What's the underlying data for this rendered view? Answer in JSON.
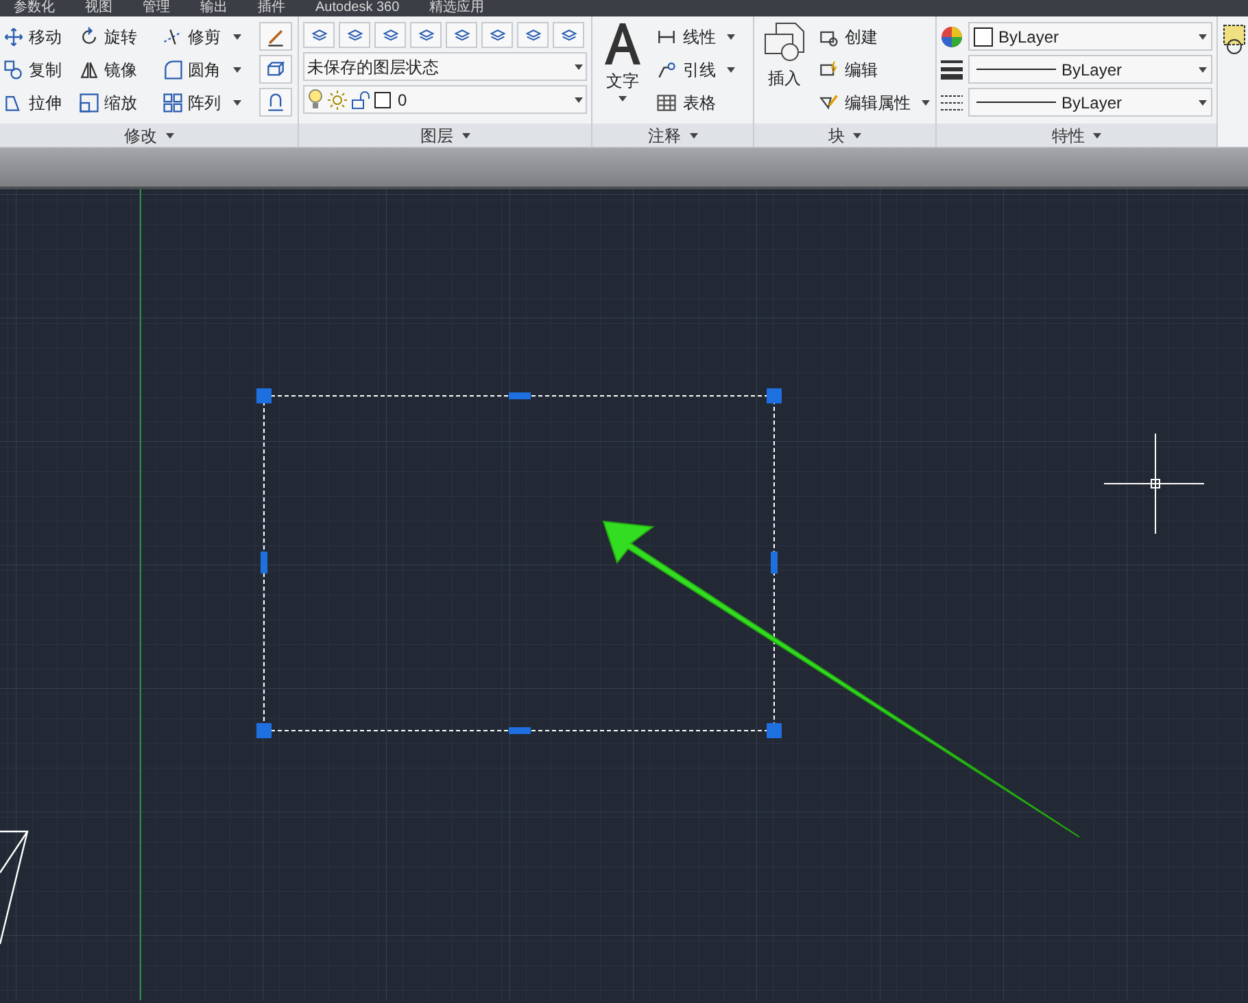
{
  "tabs": [
    "参数化",
    "视图",
    "管理",
    "输出",
    "插件",
    "Autodesk 360",
    "精选应用"
  ],
  "modify": {
    "title": "修改",
    "columns": [
      [
        {
          "label": "移动",
          "menu": false
        },
        {
          "label": "复制",
          "menu": false
        },
        {
          "label": "拉伸",
          "menu": false
        }
      ],
      [
        {
          "label": "旋转",
          "menu": false
        },
        {
          "label": "镜像",
          "menu": false
        },
        {
          "label": "缩放",
          "menu": false
        }
      ],
      [
        {
          "label": "修剪",
          "menu": true
        },
        {
          "label": "圆角",
          "menu": true
        },
        {
          "label": "阵列",
          "menu": true
        }
      ]
    ]
  },
  "layers": {
    "title": "图层",
    "state_dropdown": "未保存的图层状态",
    "layer_dropdown": "0"
  },
  "annotation": {
    "title": "注释",
    "big_tool": "文字",
    "tools": [
      {
        "label": "线性",
        "menu": true
      },
      {
        "label": "引线",
        "menu": true
      },
      {
        "label": "表格",
        "menu": false
      }
    ]
  },
  "block": {
    "title": "块",
    "big_tool": "插入",
    "tools": [
      {
        "label": "创建",
        "menu": false
      },
      {
        "label": "编辑",
        "menu": false
      },
      {
        "label": "编辑属性",
        "menu": true
      }
    ]
  },
  "properties": {
    "title": "特性",
    "color_dropdown": "ByLayer",
    "lineweight_dropdown": "ByLayer",
    "linetype_dropdown": "ByLayer"
  }
}
